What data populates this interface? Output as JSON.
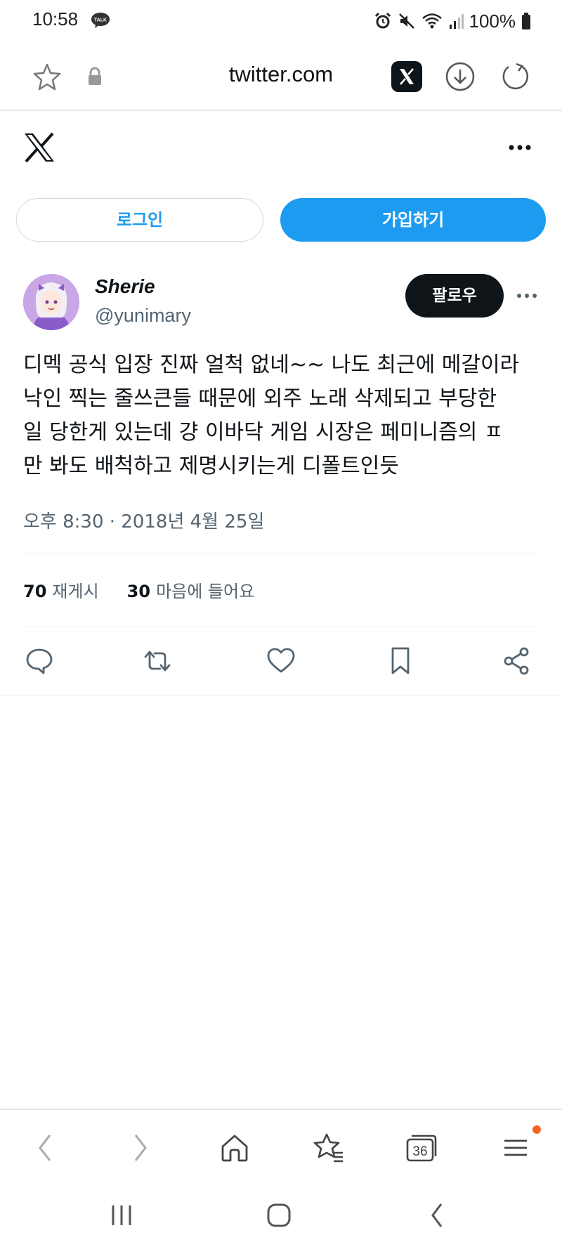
{
  "status_bar": {
    "time": "10:58",
    "talk_badge": "TALK",
    "battery": "100%",
    "icons": [
      "alarm-icon",
      "mute-icon",
      "wifi-icon",
      "signal-icon",
      "battery-icon"
    ]
  },
  "browser": {
    "url": "twitter.com",
    "icons": [
      "star-icon",
      "lock-icon",
      "x-app-icon",
      "download-icon",
      "reload-icon"
    ]
  },
  "auth": {
    "login_label": "로그인",
    "signup_label": "가입하기"
  },
  "tweet": {
    "display_name": "Sherie",
    "handle": "@yunimary",
    "follow_label": "팔로우",
    "text": "디멕 공식 입장 진짜 얼척 없네~~ 나도 최근에 메갈이라\n낙인 찍는 줄쓰큰들 때문에 외주 노래 삭제되고 부당한\n일 당한게 있는데 걍 이바닥 게임 시장은 페미니즘의 ㅍ\n만 봐도 배척하고 제명시키는게 디폴트인듯",
    "date": "오후 8:30 · 2018년 4월 25일",
    "retweets_count": "70",
    "retweets_label": "재게시",
    "likes_count": "30",
    "likes_label": "마음에 들어요"
  },
  "bottom_nav": {
    "tabs_count": "36"
  },
  "colors": {
    "accent": "#1d9bf0",
    "text": "#0f1419",
    "muted": "#536471",
    "notification": "#f26522"
  }
}
